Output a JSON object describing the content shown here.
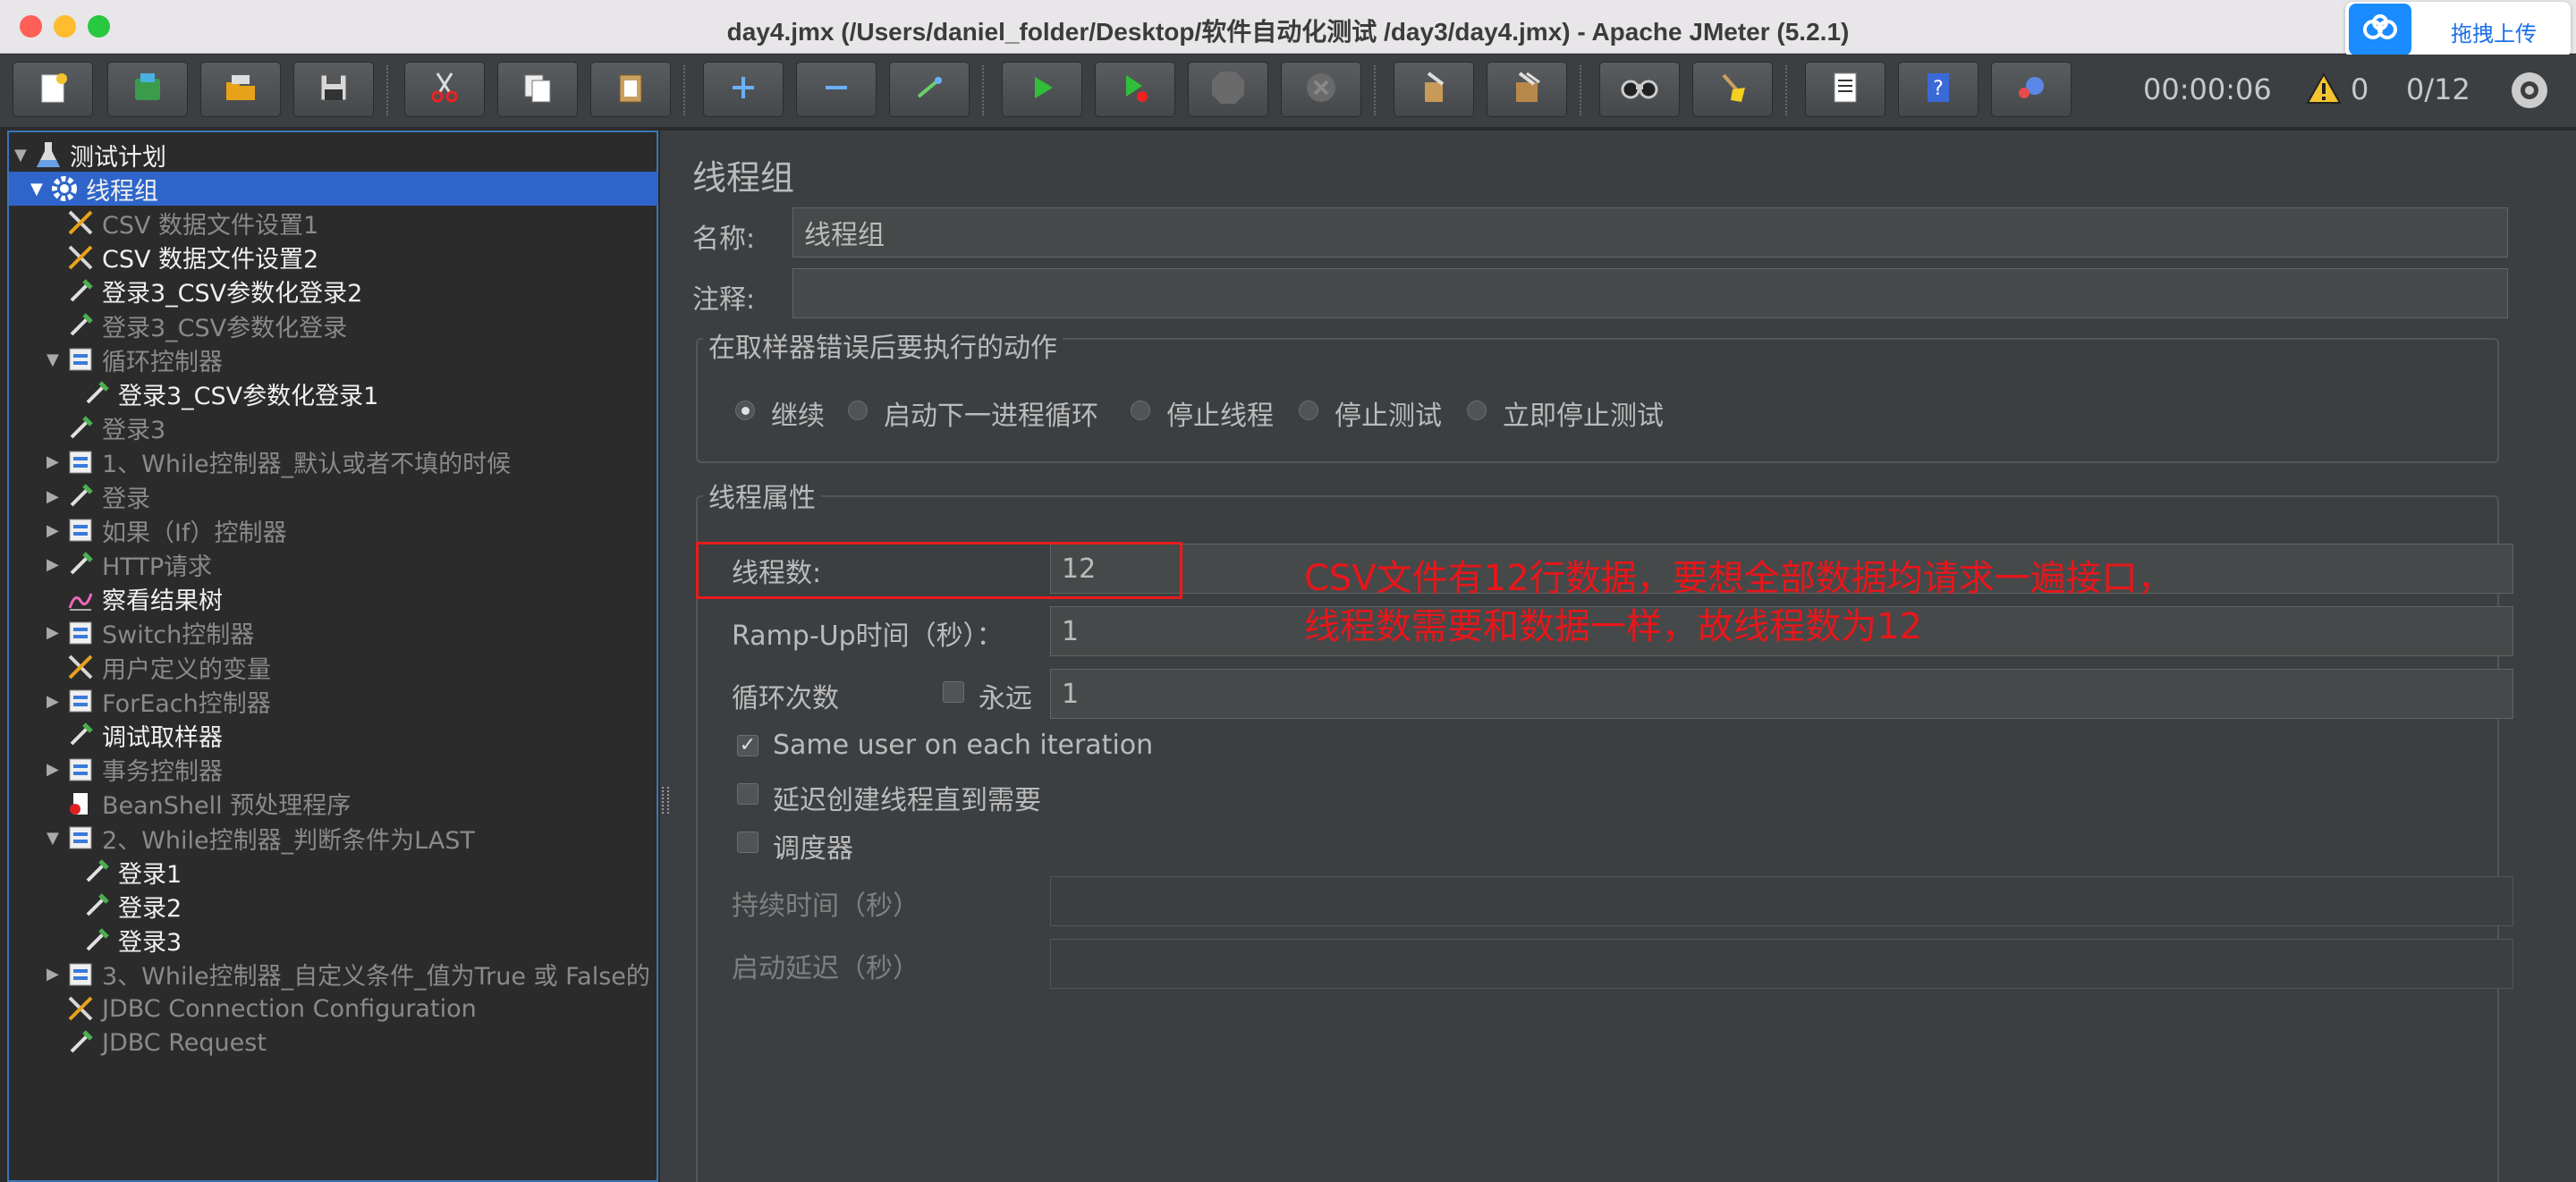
{
  "window": {
    "title": "day4.jmx (/Users/daniel_folder/Desktop/软件自动化测试 /day3/day4.jmx) - Apache JMeter (5.2.1)"
  },
  "baidu_upload": {
    "label": "拖拽上传",
    "icon": "cloud-icon"
  },
  "toolbar": {
    "buttons": [
      {
        "name": "new-icon"
      },
      {
        "name": "templates-icon"
      },
      {
        "name": "open-icon"
      },
      {
        "name": "save-icon"
      },
      {
        "name": "cut-icon"
      },
      {
        "name": "copy-icon"
      },
      {
        "name": "paste-icon"
      },
      {
        "name": "expand-icon"
      },
      {
        "name": "collapse-icon"
      },
      {
        "name": "toggle-icon"
      },
      {
        "name": "start-icon"
      },
      {
        "name": "start-no-pause-icon"
      },
      {
        "name": "stop-icon"
      },
      {
        "name": "shutdown-icon"
      },
      {
        "name": "clear-icon"
      },
      {
        "name": "clear-all-icon"
      },
      {
        "name": "search-icon"
      },
      {
        "name": "reset-search-icon"
      },
      {
        "name": "function-helper-icon"
      },
      {
        "name": "help-icon"
      },
      {
        "name": "remote-icon"
      }
    ],
    "timer": "00:00:06",
    "warning_count": "0",
    "threads": "0/12"
  },
  "tree": {
    "items": [
      {
        "label": "测试计划",
        "expanded": true,
        "icon": "flask-icon"
      },
      {
        "label": "线程组",
        "expanded": true,
        "icon": "gear-icon",
        "selected": true
      },
      {
        "label": "CSV 数据文件设置1",
        "icon": "tools-icon",
        "disabled": true
      },
      {
        "label": "CSV 数据文件设置2",
        "icon": "tools-icon"
      },
      {
        "label": "登录3_CSV参数化登录2",
        "icon": "pipette-icon"
      },
      {
        "label": "登录3_CSV参数化登录",
        "icon": "pipette-icon",
        "disabled": true
      },
      {
        "label": "循环控制器",
        "expanded": true,
        "icon": "controller-icon",
        "disabled": true
      },
      {
        "label": "登录3_CSV参数化登录1",
        "icon": "pipette-icon"
      },
      {
        "label": "登录3",
        "icon": "pipette-icon",
        "disabled": true
      },
      {
        "label": "1、While控制器_默认或者不填的时候",
        "collapsed": true,
        "icon": "controller-icon",
        "disabled": true
      },
      {
        "label": "登录",
        "collapsed": true,
        "icon": "pipette-icon",
        "disabled": true
      },
      {
        "label": "如果（If）控制器",
        "collapsed": true,
        "icon": "controller-icon",
        "disabled": true
      },
      {
        "label": "HTTP请求",
        "collapsed": true,
        "icon": "pipette-icon",
        "disabled": true
      },
      {
        "label": "察看结果树",
        "icon": "chart-icon"
      },
      {
        "label": "Switch控制器",
        "collapsed": true,
        "icon": "controller-icon",
        "disabled": true
      },
      {
        "label": "用户定义的变量",
        "icon": "tools-icon",
        "disabled": true
      },
      {
        "label": "ForEach控制器",
        "collapsed": true,
        "icon": "controller-icon",
        "disabled": true
      },
      {
        "label": "调试取样器",
        "icon": "pipette-icon"
      },
      {
        "label": "事务控制器",
        "collapsed": true,
        "icon": "controller-icon",
        "disabled": true
      },
      {
        "label": "BeanShell 预处理程序",
        "icon": "bean-icon",
        "disabled": true
      },
      {
        "label": "2、While控制器_判断条件为LAST",
        "expanded": true,
        "icon": "controller-icon",
        "disabled": true
      },
      {
        "label": "登录1",
        "icon": "pipette-icon"
      },
      {
        "label": "登录2",
        "icon": "pipette-icon"
      },
      {
        "label": "登录3",
        "icon": "pipette-icon"
      },
      {
        "label": "3、While控制器_自定义条件_值为True 或 False的",
        "collapsed": true,
        "icon": "controller-icon",
        "disabled": true
      },
      {
        "label": "JDBC Connection Configuration",
        "icon": "tools-icon",
        "disabled": true
      },
      {
        "label": "JDBC Request",
        "icon": "pipette-icon",
        "disabled": true
      }
    ]
  },
  "panel": {
    "heading": "线程组",
    "name_label": "名称:",
    "name_value": "线程组",
    "comment_label": "注释:",
    "comment_value": "",
    "error_group_title": "在取样器错误后要执行的动作",
    "error_actions": [
      {
        "label": "继续",
        "selected": true
      },
      {
        "label": "启动下一进程循环"
      },
      {
        "label": "停止线程"
      },
      {
        "label": "停止测试"
      },
      {
        "label": "立即停止测试"
      }
    ],
    "thread_group_title": "线程属性",
    "threads_label": "线程数:",
    "threads_value": "12",
    "rampup_label": "Ramp-Up时间（秒）：",
    "rampup_value": "1",
    "loop_label": "循环次数",
    "forever_label": "永远",
    "loop_value": "1",
    "same_user_label": "Same user on each iteration",
    "same_user_checked": true,
    "delay_label": "延迟创建线程直到需要",
    "scheduler_label": "调度器",
    "duration_label": "持续时间（秒）",
    "duration_value": "",
    "startup_delay_label": "启动延迟（秒）",
    "startup_delay_value": ""
  },
  "annotation": {
    "line1": "CSV文件有12行数据，要想全部数据均请求一遍接口，",
    "line2": "线程数需要和数据一样，故线程数为12",
    "color": "#e8161a"
  }
}
